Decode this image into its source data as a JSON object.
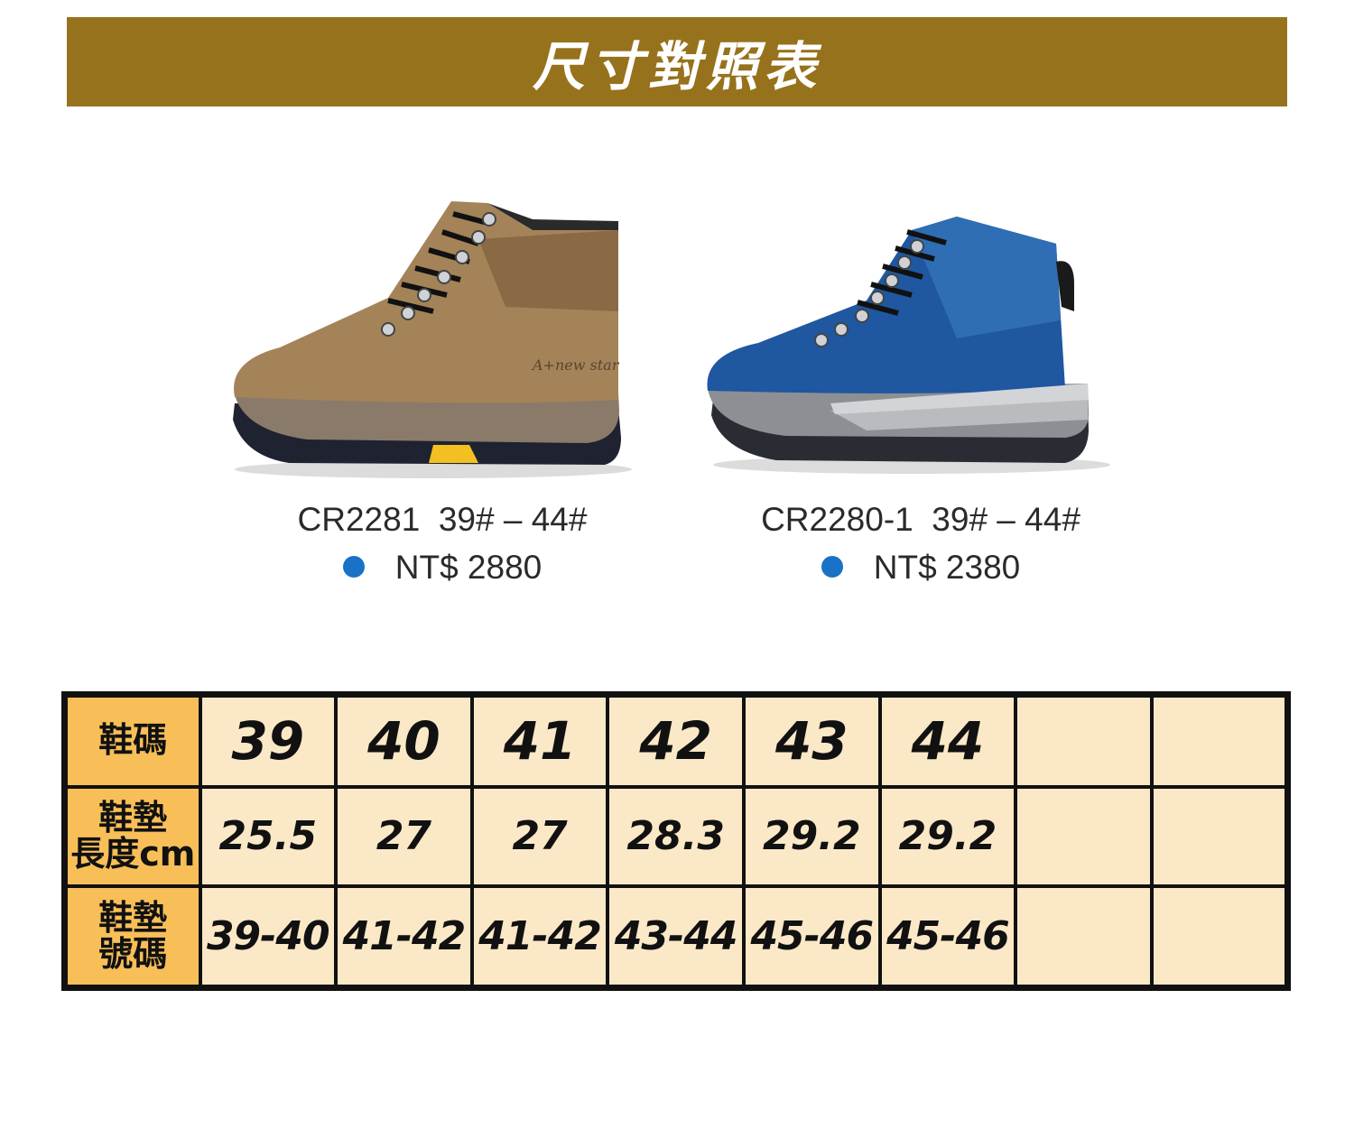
{
  "header": {
    "title": "尺寸對照表"
  },
  "products": [
    {
      "model": "CR2281",
      "size_range": "39# – 44#",
      "price": "NT$ 2880",
      "shoe_color": "#a48358",
      "shoe_logo": "A+new star"
    },
    {
      "model": "CR2280-1",
      "size_range": "39# – 44#",
      "price": "NT$ 2380",
      "shoe_color": "#1f57a0"
    }
  ],
  "colors": {
    "banner": "#97721c",
    "dot": "#1a72c6",
    "header_cell": "#f8bf58",
    "cell": "#fbe8c7"
  },
  "table": {
    "rows": [
      {
        "label": "鞋碼",
        "values": [
          "39",
          "40",
          "41",
          "42",
          "43",
          "44",
          "",
          ""
        ]
      },
      {
        "label_line1": "鞋墊",
        "label_line2": "長度cm",
        "values": [
          "25.5",
          "27",
          "27",
          "28.3",
          "29.2",
          "29.2",
          "",
          ""
        ]
      },
      {
        "label_line1": "鞋墊",
        "label_line2": "號碼",
        "values": [
          "39-40",
          "41-42",
          "41-42",
          "43-44",
          "45-46",
          "45-46",
          "",
          ""
        ]
      }
    ]
  }
}
